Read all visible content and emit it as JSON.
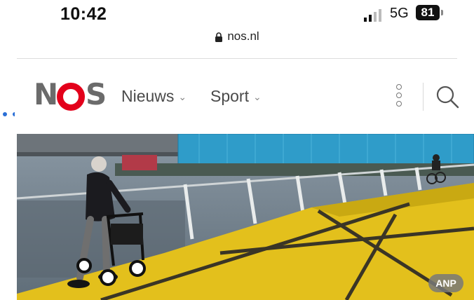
{
  "status_bar": {
    "time": "10:42",
    "network": "5G",
    "battery": "81"
  },
  "browser": {
    "url": "nos.nl"
  },
  "nav": {
    "logo_text": "NOS",
    "items": [
      {
        "label": "Nieuws"
      },
      {
        "label": "Sport"
      }
    ],
    "icons": [
      "more-vertical-icon",
      "search-icon"
    ]
  },
  "hero": {
    "credit": "ANP"
  },
  "colors": {
    "brand_red": "#e3001b",
    "logo_grey": "#6b6b6b",
    "bridge_yellow": "#e8c21f"
  }
}
